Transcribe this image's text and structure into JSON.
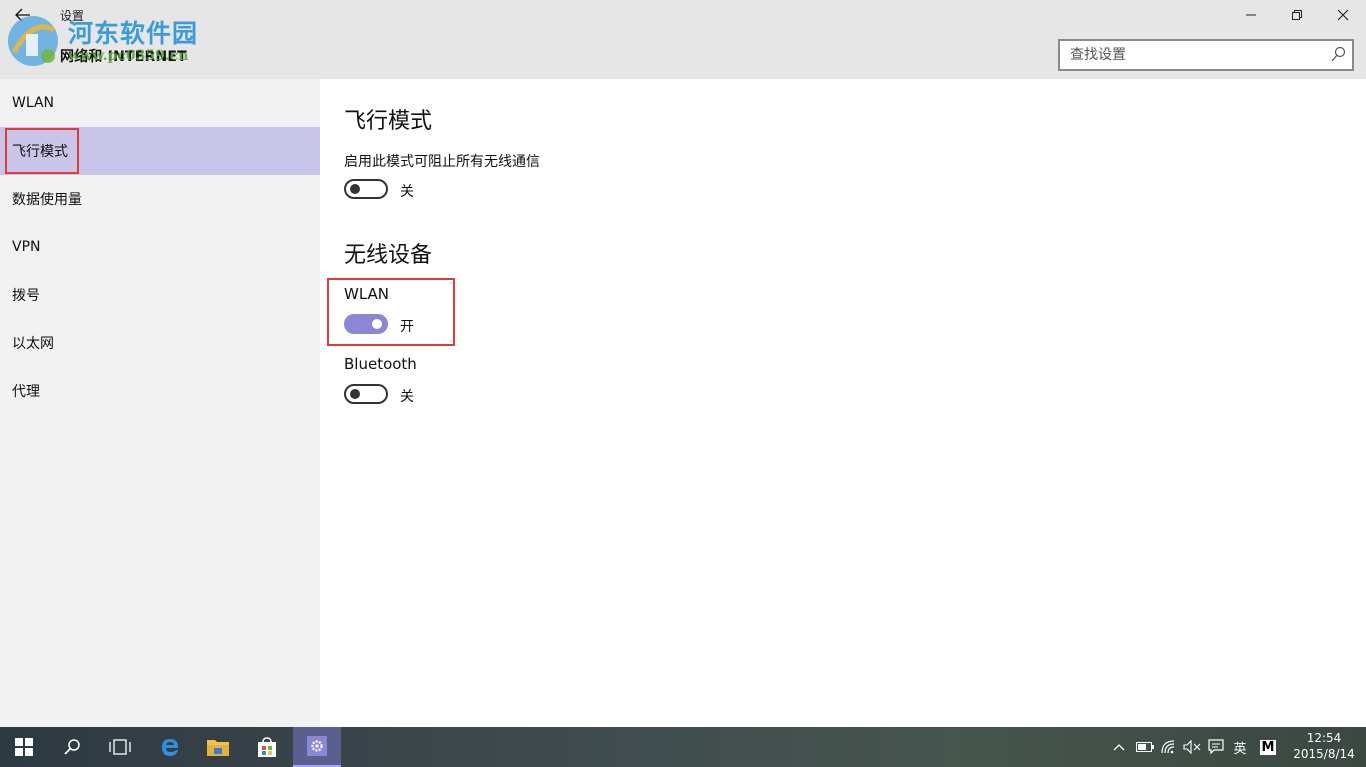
{
  "window": {
    "app_title": "设置",
    "page_heading": "网络和 INTERNET",
    "back_icon": "back-arrow-icon",
    "controls": {
      "minimize_icon": "minimize-icon",
      "maximize_icon": "restore-icon",
      "close_icon": "close-icon"
    }
  },
  "watermark": {
    "text": "河东软件园",
    "url": "www.pc0359.cn"
  },
  "search": {
    "placeholder": "查找设置",
    "value": ""
  },
  "sidebar": {
    "items": [
      {
        "label": "WLAN",
        "selected": false
      },
      {
        "label": "飞行模式",
        "selected": true
      },
      {
        "label": "数据使用量",
        "selected": false
      },
      {
        "label": "VPN",
        "selected": false
      },
      {
        "label": "拨号",
        "selected": false
      },
      {
        "label": "以太网",
        "selected": false
      },
      {
        "label": "代理",
        "selected": false
      }
    ]
  },
  "main": {
    "airplane": {
      "title": "飞行模式",
      "description": "启用此模式可阻止所有无线通信",
      "state": "关",
      "on": false
    },
    "wireless": {
      "title": "无线设备",
      "wlan": {
        "label": "WLAN",
        "state": "开",
        "on": true
      },
      "bluetooth": {
        "label": "Bluetooth",
        "state": "关",
        "on": false
      }
    }
  },
  "colors": {
    "accent": "#8b86d6",
    "selected_nav": "#c9c5e9",
    "highlight_border": "#e03a3a"
  },
  "taskbar": {
    "apps": [
      "windows-start-icon",
      "search-icon",
      "task-view-icon",
      "edge-icon",
      "file-explorer-icon",
      "store-icon",
      "settings-icon"
    ],
    "tray": {
      "ime": "英",
      "ime_mode": "M",
      "time": "12:54",
      "date": "2015/8/14"
    }
  }
}
